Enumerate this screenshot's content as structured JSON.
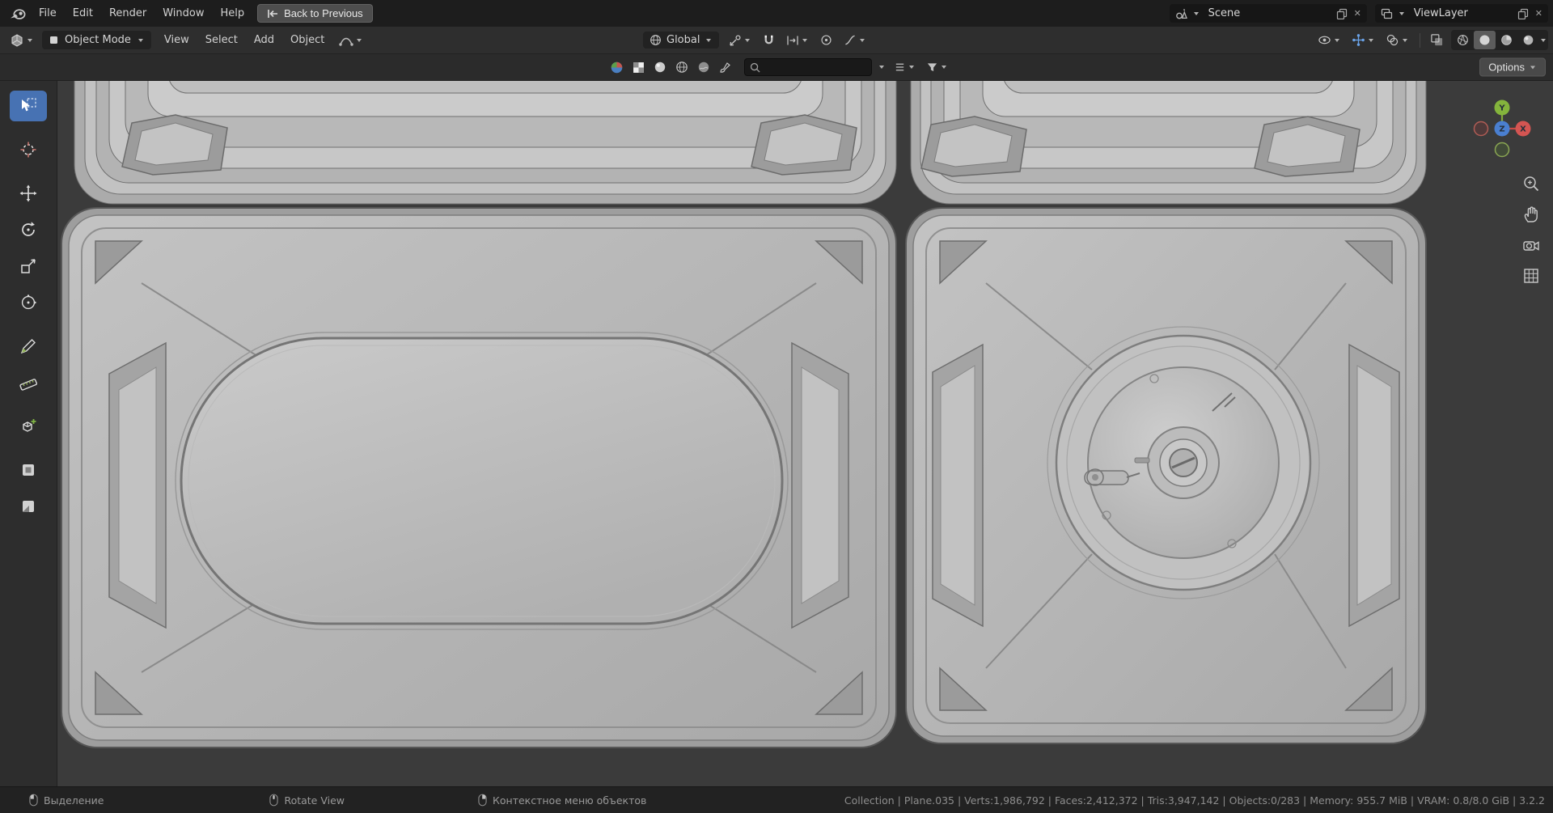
{
  "topbar": {
    "menus": [
      "File",
      "Edit",
      "Render",
      "Window",
      "Help"
    ],
    "back_button": "Back to Previous",
    "scene": {
      "value": "Scene"
    },
    "view_layer": {
      "value": "ViewLayer"
    }
  },
  "header": {
    "mode": "Object Mode",
    "menus": [
      "View",
      "Select",
      "Add",
      "Object"
    ],
    "orientation": "Global",
    "options_button": "Options"
  },
  "statusbar": {
    "hints": [
      {
        "button": "left-mouse",
        "label": "Выделение"
      },
      {
        "button": "middle-mouse",
        "label": "Rotate View"
      },
      {
        "button": "right-mouse",
        "label": "Контекстное меню объектов"
      }
    ],
    "stats": {
      "collection": "Collection",
      "active_object": "Plane.035",
      "verts": "Verts:1,986,792",
      "faces": "Faces:2,412,372",
      "tris": "Tris:3,947,142",
      "objects": "Objects:0/283",
      "memory": "Memory: 955.7 MiB",
      "vram": "VRAM: 0.8/8.0 GiB",
      "version": "3.2.2"
    },
    "stats_text": "Collection | Plane.035 | Verts:1,986,792 | Faces:2,412,372 | Tris:3,947,142 | Objects:0/283 | Memory: 955.7 MiB | VRAM: 0.8/8.0 GiB | 3.2.2"
  },
  "gizmo": {
    "axis_x": "X",
    "axis_y": "Y",
    "axis_z": "Z"
  },
  "icons": {
    "close": "✕"
  },
  "colors": {
    "accent": "#4772b3",
    "axis_x": "#d45552",
    "axis_y": "#84b43c",
    "axis_z": "#4a7fd0"
  }
}
